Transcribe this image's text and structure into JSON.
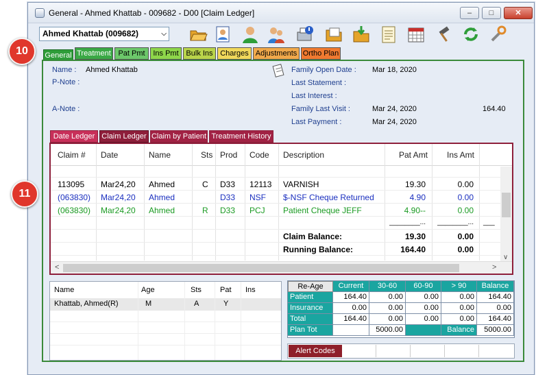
{
  "window": {
    "title": "General - Ahmed Khattab - 009682 - D00 [Claim Ledger]",
    "min": "–",
    "max": "□",
    "close": "✕"
  },
  "patient_selector": {
    "value": "Ahmed Khattab (009682)"
  },
  "toolbar": [
    "folder-open-icon",
    "patient-card-icon",
    "person-icon",
    "family-icon",
    "printer-alert-icon",
    "folder-list-icon",
    "folder-download-icon",
    "notes-icon",
    "calendar-icon",
    "hammer-icon",
    "refresh-icon",
    "tools-icon"
  ],
  "tabs": [
    {
      "label": "General",
      "bg": "#2e9d3a"
    },
    {
      "label": "Treatment",
      "bg": "#3aa845"
    },
    {
      "label": "Pat Pmt",
      "bg": "#6cc86a"
    },
    {
      "label": "Ins Pmt",
      "bg": "#8ed64a"
    },
    {
      "label": "Bulk Ins",
      "bg": "#b9d44a"
    },
    {
      "label": "Charges",
      "bg": "#f0d85a"
    },
    {
      "label": "Adjustments",
      "bg": "#f0a84a"
    },
    {
      "label": "Ortho Plan",
      "bg": "#f07a30"
    }
  ],
  "info": {
    "name_label": "Name :",
    "name_value": "Ahmed Khattab",
    "pnote_label": "P-Note :",
    "anote_label": "A-Note :",
    "family_open_label": "Family Open Date :",
    "family_open_value": "Mar 18, 2020",
    "last_statement_label": "Last Statement :",
    "last_interest_label": "Last Interest :",
    "family_last_visit_label": "Family Last Visit :",
    "family_last_visit_value": "Mar 24, 2020",
    "family_last_visit_amount": "164.40",
    "last_payment_label": "Last Payment :",
    "last_payment_value": "Mar 24, 2020"
  },
  "ledger_tabs": [
    {
      "label": "Date Ledger"
    },
    {
      "label": "Claim Ledger"
    },
    {
      "label": "Claim by Patient"
    },
    {
      "label": "Treatment History"
    }
  ],
  "ledger": {
    "headers": [
      "Claim #",
      "Date",
      "Name",
      "Sts",
      "Prod",
      "Code",
      "Description",
      "Pat Amt",
      "Ins Amt"
    ],
    "rows": [
      {
        "claim": "113095",
        "date": "Mar24,20",
        "name": "Ahmed",
        "sts": "C",
        "prod": "D33",
        "code": "12113",
        "desc": "VARNISH",
        "pat": "19.30",
        "ins": "0.00",
        "color": "#000000",
        "bold": false
      },
      {
        "claim": "(063830)",
        "date": "Mar24,20",
        "name": "Ahmed",
        "sts": "",
        "prod": "D33",
        "code": "NSF",
        "desc": "$-NSF Cheque Returned",
        "pat": "4.90",
        "ins": "0.00",
        "color": "#1a2fbf",
        "bold": false
      },
      {
        "claim": "(063830)",
        "date": "Mar24,20",
        "name": "Ahmed",
        "sts": "R",
        "prod": "D33",
        "code": "PCJ",
        "desc": "Patient Cheque JEFF",
        "pat": "4.90--",
        "ins": "0.00",
        "color": "#1a9a22",
        "bold": false
      }
    ],
    "sep1": "________...",
    "sep2": "________...",
    "sep3": "___",
    "claim_balance_label": "Claim Balance:",
    "claim_balance_pat": "19.30",
    "claim_balance_ins": "0.00",
    "running_balance_label": "Running Balance:",
    "running_balance_pat": "164.40",
    "running_balance_ins": "0.00",
    "scroll_left": "<",
    "scroll_right": ">",
    "scroll_down": "∨"
  },
  "patients_table": {
    "headers": [
      "Name",
      "Age",
      "Sts",
      "Pat",
      "Ins"
    ],
    "rows": [
      {
        "name": "Khattab, Ahmed(R)",
        "age": "M",
        "sts": "A",
        "pat": "Y",
        "ins": ""
      }
    ]
  },
  "aging": {
    "reage": "Re-Age",
    "headers": [
      "Current",
      "30-60",
      "60-90",
      "> 90",
      "Balance"
    ],
    "rows": [
      {
        "label": "Patient",
        "values": [
          "164.40",
          "0.00",
          "0.00",
          "0.00",
          "164.40"
        ]
      },
      {
        "label": "Insurance",
        "values": [
          "0.00",
          "0.00",
          "0.00",
          "0.00",
          "0.00"
        ]
      },
      {
        "label": "Total",
        "values": [
          "164.40",
          "0.00",
          "0.00",
          "0.00",
          "164.40"
        ]
      }
    ],
    "plan_tot_label": "Plan Tot",
    "plan_tot_value": "5000.00",
    "balance_label": "Balance",
    "balance_value": "5000.00"
  },
  "alert_codes": {
    "label": "Alert Codes"
  },
  "callouts": [
    "10",
    "11"
  ]
}
